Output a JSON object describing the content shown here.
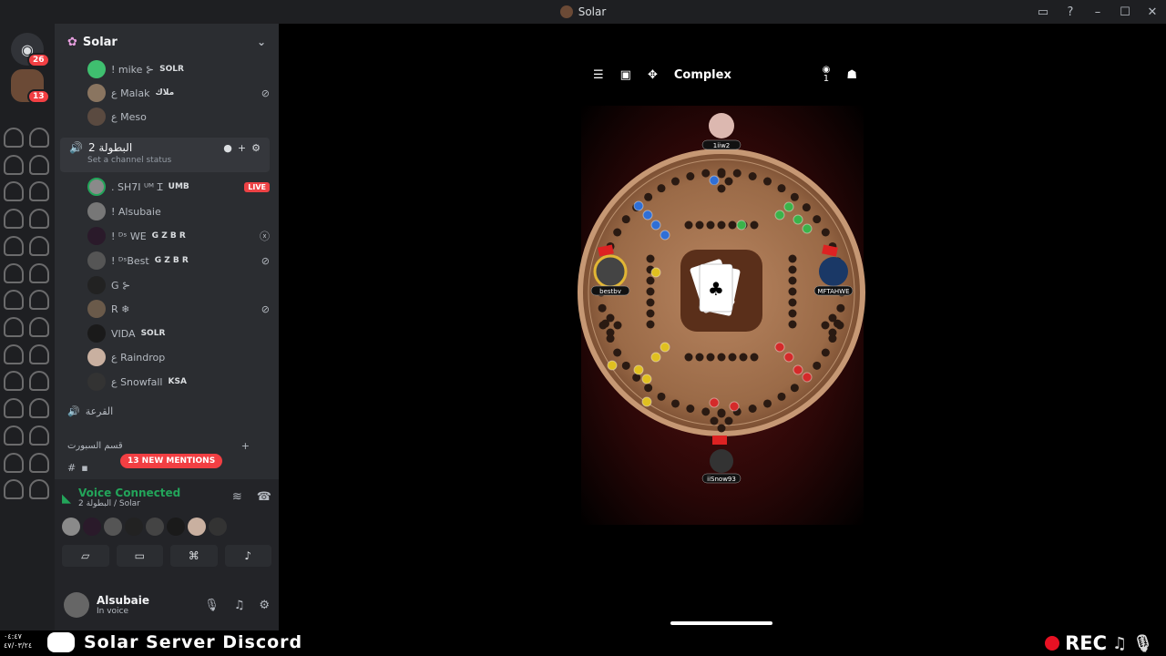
{
  "window": {
    "title": "Solar"
  },
  "server_rail": {
    "home_badge": "26",
    "server_badge": "13"
  },
  "server": {
    "name": "Solar"
  },
  "top_users": [
    {
      "name": "! mike ⊱",
      "tag": "SOLR"
    },
    {
      "name": "ع Malak",
      "tag": "ملاك"
    },
    {
      "name": "ع Meso",
      "tag": ""
    }
  ],
  "voice_channel": {
    "name": "البطولة 2",
    "status": "Set a channel status"
  },
  "channel_users": [
    {
      "name": ". SH7I ᵁᴹ Ɪ",
      "tag": "UMB",
      "extra": "LIVE"
    },
    {
      "name": "! Alsubaie",
      "tag": "",
      "extra": ""
    },
    {
      "name": "! ᴰˢ WE",
      "tag": "G Z B R",
      "extra": ""
    },
    {
      "name": "! ᴰˢBest",
      "tag": "G Z B R",
      "extra": ""
    },
    {
      "name": "G ⊱",
      "tag": "",
      "extra": ""
    },
    {
      "name": "R ❄",
      "tag": "",
      "extra": ""
    },
    {
      "name": "VIDA",
      "tag": "SOLR",
      "extra": ""
    },
    {
      "name": "ع Raindrop",
      "tag": "",
      "extra": ""
    },
    {
      "name": "ع Snowfall",
      "tag": "KSA",
      "extra": ""
    }
  ],
  "other_channel": {
    "name": "القرعة"
  },
  "category": {
    "name": "قسم السبورت"
  },
  "mentions_pill": "13 NEW MENTIONS",
  "voice_status": {
    "label": "Voice Connected",
    "sub": "البطولة 2 / Solar"
  },
  "user": {
    "name": "Alsubaie",
    "status": "In voice"
  },
  "game": {
    "mode_label": "Complex",
    "watchers": "1",
    "players": [
      "1iiw2",
      "bestbv",
      "MFTAHWE",
      "iiSnow93"
    ],
    "colors": {
      "blue": "#2f6fd6",
      "green": "#3bb34a",
      "yellow": "#e0c020",
      "red": "#d42a2a",
      "wood": "#a97552"
    }
  },
  "bottom_bar": {
    "server_label": "Solar Server Discord",
    "rec_label": "REC",
    "clock": "٠٤:٤٧\n٤٧/٠٣/٢٤"
  }
}
